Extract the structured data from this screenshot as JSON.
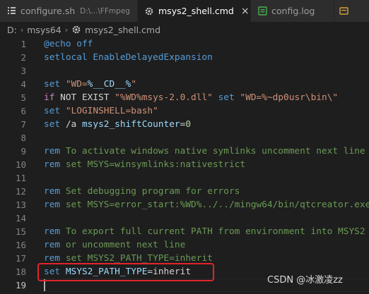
{
  "tabs": [
    {
      "label": "configure.sh",
      "description": "D:\\...\\FFmpeg",
      "icon": "file-icon"
    },
    {
      "label": "msys2_shell.cmd",
      "icon": "gear-icon",
      "close": "×"
    },
    {
      "label": "config.log",
      "icon": "log-file-icon"
    }
  ],
  "breadcrumb": {
    "parts": [
      "D:",
      "msys64",
      "msys2_shell.cmd"
    ],
    "separator": "›"
  },
  "lines": [
    {
      "num": "1",
      "tokens": [
        {
          "t": "@echo",
          "c": "k"
        },
        {
          "t": " off",
          "c": "k"
        }
      ]
    },
    {
      "num": "2",
      "tokens": [
        {
          "t": "setlocal",
          "c": "k"
        },
        {
          "t": " EnableDelayedExpansion",
          "c": "k"
        }
      ]
    },
    {
      "num": "3",
      "tokens": []
    },
    {
      "num": "4",
      "tokens": [
        {
          "t": "set",
          "c": "k"
        },
        {
          "t": " ",
          "c": ""
        },
        {
          "t": "\"WD=",
          "c": "s"
        },
        {
          "t": "%__CD__%",
          "c": "v"
        },
        {
          "t": "\"",
          "c": "s"
        }
      ]
    },
    {
      "num": "5",
      "tokens": [
        {
          "t": "if",
          "c": "k2"
        },
        {
          "t": " NOT EXIST ",
          "c": ""
        },
        {
          "t": "\"%WD%msys-2.0.dll\"",
          "c": "s"
        },
        {
          "t": " ",
          "c": ""
        },
        {
          "t": "set",
          "c": "k"
        },
        {
          "t": " ",
          "c": ""
        },
        {
          "t": "\"WD=%~dp0usr\\bin\\\"",
          "c": "s"
        }
      ]
    },
    {
      "num": "6",
      "tokens": [
        {
          "t": "set",
          "c": "k"
        },
        {
          "t": " ",
          "c": ""
        },
        {
          "t": "\"LOGINSHELL=bash\"",
          "c": "s"
        }
      ]
    },
    {
      "num": "7",
      "tokens": [
        {
          "t": "set",
          "c": "k"
        },
        {
          "t": " /a ",
          "c": ""
        },
        {
          "t": "msys2_shiftCounter",
          "c": "v"
        },
        {
          "t": "=",
          "c": ""
        },
        {
          "t": "0",
          "c": "n"
        }
      ]
    },
    {
      "num": "8",
      "tokens": []
    },
    {
      "num": "9",
      "tokens": [
        {
          "t": "rem",
          "c": "k"
        },
        {
          "t": " To activate windows native symlinks uncomment next line",
          "c": "cm"
        }
      ]
    },
    {
      "num": "10",
      "tokens": [
        {
          "t": "rem",
          "c": "k"
        },
        {
          "t": " set MSYS=winsymlinks:nativestrict",
          "c": "cm"
        }
      ]
    },
    {
      "num": "11",
      "tokens": []
    },
    {
      "num": "12",
      "tokens": [
        {
          "t": "rem",
          "c": "k"
        },
        {
          "t": " Set debugging program for errors",
          "c": "cm"
        }
      ]
    },
    {
      "num": "13",
      "tokens": [
        {
          "t": "rem",
          "c": "k"
        },
        {
          "t": " set MSYS=error_start:%WD%../../mingw64/bin/qtcreator.exe",
          "c": "cm"
        }
      ]
    },
    {
      "num": "14",
      "tokens": []
    },
    {
      "num": "15",
      "tokens": [
        {
          "t": "rem",
          "c": "k"
        },
        {
          "t": " To export full current PATH from environment into MSYS2",
          "c": "cm"
        }
      ]
    },
    {
      "num": "16",
      "tokens": [
        {
          "t": "rem",
          "c": "k"
        },
        {
          "t": " or uncomment next line",
          "c": "cm"
        }
      ]
    },
    {
      "num": "17",
      "tokens": [
        {
          "t": "rem",
          "c": "k"
        },
        {
          "t": " set MSYS2_PATH_TYPE=inherit",
          "c": "cm"
        }
      ]
    },
    {
      "num": "18",
      "tokens": [
        {
          "t": "set",
          "c": "k"
        },
        {
          "t": " ",
          "c": ""
        },
        {
          "t": "MSYS2_PATH_TYPE",
          "c": "v"
        },
        {
          "t": "=inherit",
          "c": ""
        }
      ]
    },
    {
      "num": "19",
      "tokens": []
    }
  ],
  "current_line": "19",
  "watermark": "CSDN @冰激凌zz",
  "colors": {
    "keyword": "#569cd6",
    "string": "#ce9178",
    "variable": "#9cdcfe",
    "comment": "#6a9955",
    "highlight_box": "#e0252b"
  }
}
